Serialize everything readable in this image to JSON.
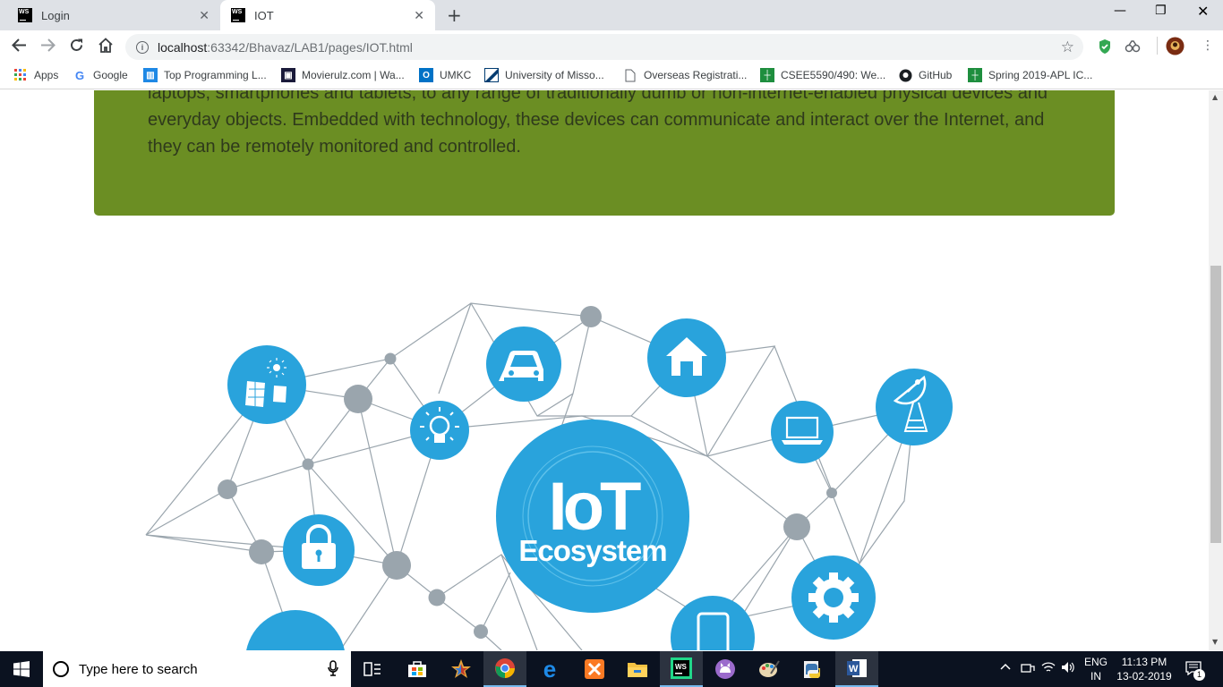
{
  "browser": {
    "tabs": [
      {
        "label": "Login",
        "icon": "webstorm-icon"
      },
      {
        "label": "IOT",
        "icon": "webstorm-icon"
      }
    ],
    "url_host": "localhost",
    "url_path": ":63342/Bhavaz/LAB1/pages/IOT.html",
    "bookmarks": [
      {
        "label": "Apps"
      },
      {
        "label": "Google"
      },
      {
        "label": "Top Programming L..."
      },
      {
        "label": "Movierulz.com | Wa..."
      },
      {
        "label": "UMKC"
      },
      {
        "label": "University of Misso..."
      },
      {
        "label": "Overseas Registrati..."
      },
      {
        "label": "CSEE5590/490: We..."
      },
      {
        "label": "GitHub"
      },
      {
        "label": "Spring 2019-APL IC..."
      }
    ]
  },
  "page": {
    "intro_text": "laptops, smartphones and tablets, to any range of traditionally dumb or non-internet-enabled physical devices and everyday objects. Embedded with technology, these devices can communicate and interact over the Internet, and they can be remotely monitored and controlled.",
    "banner_color": "#6b8e23",
    "diagram": {
      "center_title": "IoT",
      "center_subtitle": "Ecosystem",
      "node_color": "#29a3dc",
      "dot_color": "#9aa5ad",
      "icons": [
        "solar-panel-icon",
        "car-icon",
        "house-icon",
        "laptop-icon",
        "satellite-dish-icon",
        "lightbulb-icon",
        "padlock-icon",
        "gear-icon",
        "smartphone-icon"
      ]
    }
  },
  "taskbar": {
    "search_placeholder": "Type here to search",
    "lang_top": "ENG",
    "lang_bottom": "IN",
    "time": "11:13 PM",
    "date": "13-02-2019",
    "notification_count": "1"
  }
}
